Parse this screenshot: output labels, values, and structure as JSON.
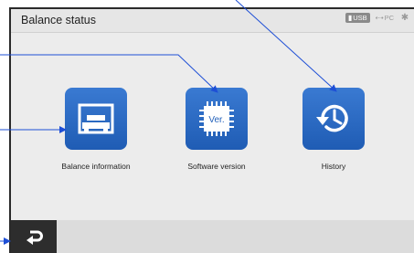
{
  "header": {
    "title": "Balance status",
    "usb_label": "USB",
    "pc_label": "PC",
    "icons": [
      "usb-icon",
      "pc-connection-icon",
      "bluetooth-icon"
    ]
  },
  "tiles": [
    {
      "label": "Balance information",
      "icon": "balance-icon"
    },
    {
      "label": "Software version",
      "icon": "chip-version-icon",
      "icon_text": "Ver."
    },
    {
      "label": "History",
      "icon": "history-icon"
    }
  ],
  "footer": {
    "back_icon": "return-arrow-icon"
  },
  "colors": {
    "tile": "#2a6cc8",
    "background": "#ececec",
    "footer": "#dcdcdc",
    "back_button": "#2d2d2d",
    "callout": "#1e4fd6"
  }
}
